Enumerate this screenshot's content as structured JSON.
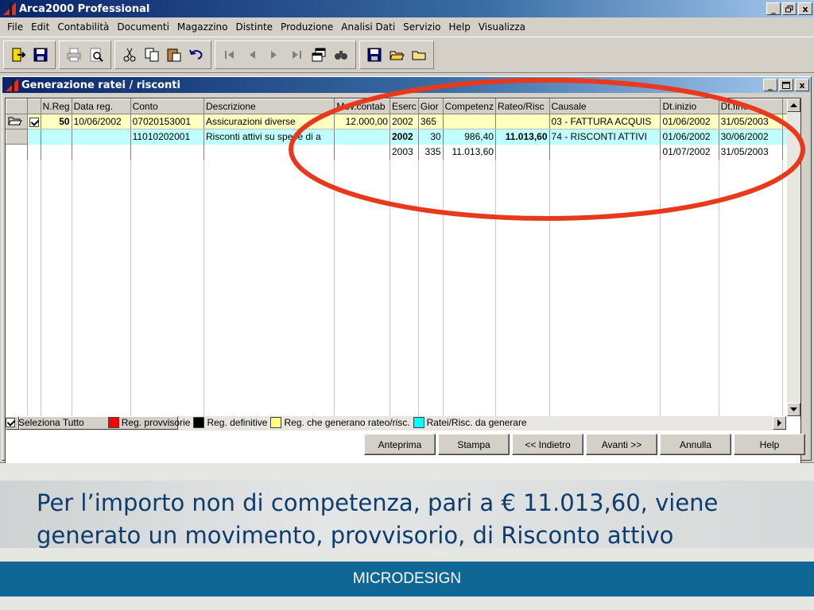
{
  "app": {
    "title": "Arca2000 Professional",
    "window_buttons": [
      "_",
      " ̸",
      "x"
    ],
    "menu": [
      "File",
      "Edit",
      "Contabilità",
      "Documenti",
      "Magazzino",
      "Distinte",
      "Produzione",
      "Analisi Dati",
      "Servizio",
      "Help",
      "Visualizza"
    ]
  },
  "toolbar": {
    "icons": [
      "exit-icon",
      "save-icon",
      "print-icon",
      "print-preview-icon",
      "cut-icon",
      "copy-icon",
      "paste-icon",
      "undo-icon",
      "first-record-icon",
      "previous-record-icon",
      "next-record-icon",
      "last-record-icon",
      "window-icon",
      "find-icon",
      "save-icon",
      "open-folder-icon",
      "new-folder-icon"
    ]
  },
  "child": {
    "title": "Generazione ratei / risconti",
    "columns": [
      "N.Reg",
      "Data reg.",
      "Conto",
      "Descrizione",
      "Mov.contab",
      "Eserc",
      "Gior",
      "Competenz",
      "Rateo/Risc",
      "Causale",
      "Dt.inizio",
      "Dt.fine"
    ],
    "rows": [
      {
        "nreg": "50",
        "data_reg": "10/06/2002",
        "conto": "07020153001",
        "descrizione": "Assicurazioni diverse",
        "mov_contab": "12.000,00",
        "eserc": "2002",
        "gior": "365",
        "competenza": "",
        "rateo_risc": "",
        "causale": "03 - FATTURA ACQUIS",
        "dt_inizio": "01/06/2002",
        "dt_fine": "31/05/2003"
      },
      {
        "nreg": "",
        "data_reg": "",
        "conto": "11010202001",
        "descrizione": "Risconti attivi su spese di a",
        "mov_contab": "",
        "eserc": "2002",
        "gior": "30",
        "competenza": "986,40",
        "rateo_risc": "11.013,60",
        "causale": "74 - RISCONTI ATTIVI",
        "dt_inizio": "01/06/2002",
        "dt_fine": "30/06/2002"
      },
      {
        "nreg": "",
        "data_reg": "",
        "conto": "",
        "descrizione": "",
        "mov_contab": "",
        "eserc": "2003",
        "gior": "335",
        "competenza": "11.013,60",
        "rateo_risc": "",
        "causale": "",
        "dt_inizio": "01/07/2002",
        "dt_fine": "31/05/2003"
      }
    ],
    "select_all_label": "Seleziona Tutto",
    "legend": [
      {
        "label": "Reg. provvisorie",
        "color": "#ff0000"
      },
      {
        "label": "Reg. definitive",
        "color": "#000000"
      },
      {
        "label": "Reg. che generano rateo/risc.",
        "color": "#ffff80"
      },
      {
        "label": "Ratei/Risc. da generare",
        "color": "#00ffff"
      }
    ],
    "buttons": [
      "Anteprima",
      "Stampa",
      "<< Indietro",
      "Avanti >>",
      "Annulla",
      "Help"
    ]
  },
  "highlight_color": "#e8391c",
  "slide": {
    "caption": "Per l’importo non di competenza, pari a € 11.013,60, viene generato un movimento, provvisorio, di Risconto attivo",
    "brand": "MICRODESIGN",
    "caption_color": "#0d3c6e",
    "brand_bar_color": "#0e6794"
  }
}
